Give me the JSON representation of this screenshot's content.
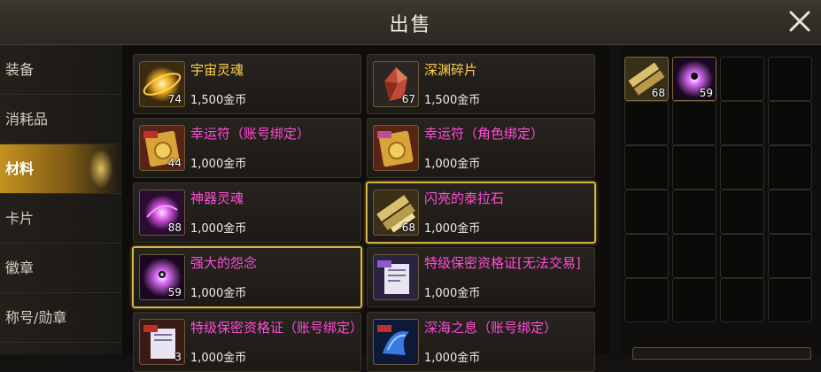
{
  "header": {
    "title": "出售"
  },
  "sidebar": {
    "items": [
      {
        "label": "装备"
      },
      {
        "label": "消耗品"
      },
      {
        "label": "材料"
      },
      {
        "label": "卡片"
      },
      {
        "label": "徽章"
      },
      {
        "label": "称号/勋章"
      }
    ],
    "active_index": 2
  },
  "items": [
    {
      "name": "宇宙灵魂",
      "price": "1,500金币",
      "count": "74",
      "icon": "gold-soul-orb-icon",
      "name_color": "gold"
    },
    {
      "name": "深渊碎片",
      "price": "1,500金币",
      "count": "67",
      "icon": "red-crystal-icon",
      "name_color": "gold"
    },
    {
      "name": "幸运符（账号绑定）",
      "price": "1,000金币",
      "count": "44",
      "icon": "lucky-charm-account-icon",
      "name_color": "magenta"
    },
    {
      "name": "幸运符（角色绑定）",
      "price": "1,000金币",
      "count": "",
      "icon": "lucky-charm-character-icon",
      "name_color": "magenta"
    },
    {
      "name": "神器灵魂",
      "price": "1,000金币",
      "count": "88",
      "icon": "artifact-soul-icon",
      "name_color": "magenta"
    },
    {
      "name": "闪亮的泰拉石",
      "price": "1,000金币",
      "count": "68",
      "icon": "shiny-terra-stone-icon",
      "name_color": "magenta",
      "selected": true
    },
    {
      "name": "强大的怨念",
      "price": "1,000金币",
      "count": "59",
      "icon": "powerful-grudge-icon",
      "name_color": "magenta",
      "selected": true
    },
    {
      "name": "特级保密资格证[无法交易]",
      "price": "1,000金币",
      "count": "",
      "icon": "secret-certificate-icon",
      "name_color": "magenta"
    },
    {
      "name": "特级保密资格证（账号绑定）",
      "price": "1,000金币",
      "count": "3",
      "icon": "secret-certificate-account-icon",
      "name_color": "magenta"
    },
    {
      "name": "深海之息（账号绑定）",
      "price": "1,000金币",
      "count": "",
      "icon": "deep-sea-breath-icon",
      "name_color": "magenta"
    }
  ],
  "sell_grid": {
    "slots": [
      {
        "count": "68",
        "icon": "shiny-terra-stone-icon"
      },
      {
        "count": "59",
        "icon": "powerful-grudge-icon"
      }
    ]
  },
  "colors": {
    "accent_gold": "#d6b24a",
    "name_magenta": "#ff4dd8",
    "name_gold": "#ffd34d"
  }
}
